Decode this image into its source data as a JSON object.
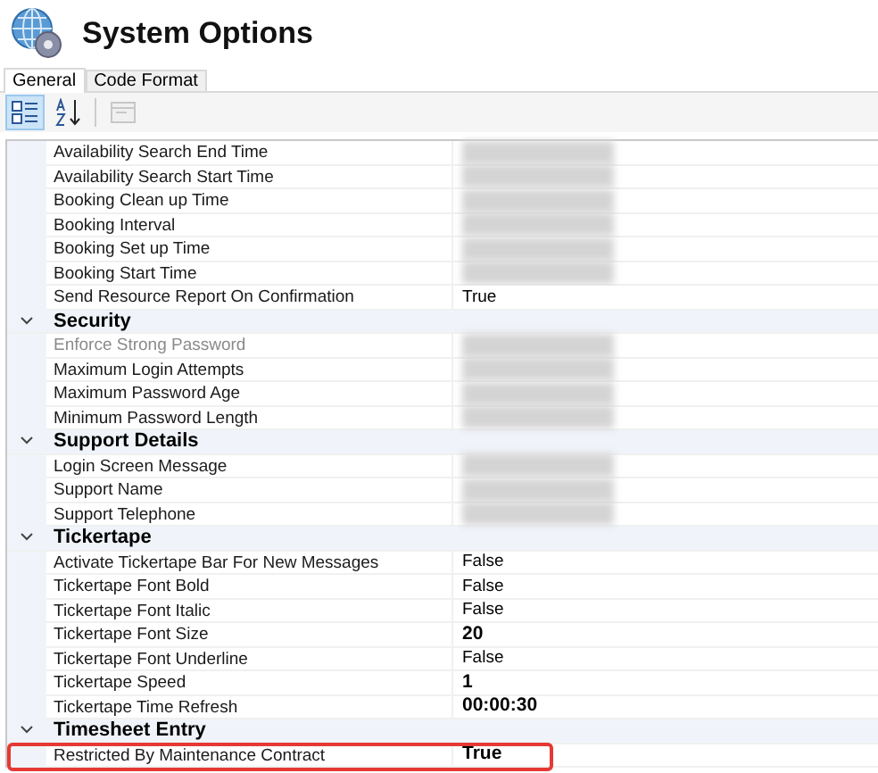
{
  "window": {
    "title": "System Options"
  },
  "tabs": [
    {
      "label": "General",
      "selected": true
    },
    {
      "label": "Code Format",
      "selected": false
    }
  ],
  "toolbar": [
    {
      "kind": "categorized",
      "selected": true,
      "disabled": false
    },
    {
      "kind": "alphabetical",
      "selected": false,
      "disabled": false
    },
    {
      "kind": "pages",
      "selected": false,
      "disabled": true
    }
  ],
  "grid": [
    {
      "kind": "property",
      "name": "Availability Search End Time",
      "redacted": true
    },
    {
      "kind": "property",
      "name": "Availability Search Start Time",
      "redacted": true
    },
    {
      "kind": "property",
      "name": "Booking Clean up Time",
      "redacted": true
    },
    {
      "kind": "property",
      "name": "Booking Interval",
      "redacted": true
    },
    {
      "kind": "property",
      "name": "Booking Set up Time",
      "redacted": true
    },
    {
      "kind": "property",
      "name": "Booking Start Time",
      "redacted": true
    },
    {
      "kind": "property",
      "name": "Send Resource Report On Confirmation",
      "value": "True",
      "modified": false
    },
    {
      "kind": "category",
      "name": "Security",
      "expanded": true
    },
    {
      "kind": "property",
      "name": "Enforce Strong Password",
      "redacted": true,
      "disabled": true
    },
    {
      "kind": "property",
      "name": "Maximum Login Attempts",
      "redacted": true
    },
    {
      "kind": "property",
      "name": "Maximum Password Age",
      "redacted": true
    },
    {
      "kind": "property",
      "name": "Minimum Password Length",
      "redacted": true
    },
    {
      "kind": "category",
      "name": "Support Details",
      "expanded": true
    },
    {
      "kind": "property",
      "name": "Login Screen Message",
      "redacted": true
    },
    {
      "kind": "property",
      "name": "Support Name",
      "redacted": true
    },
    {
      "kind": "property",
      "name": "Support Telephone",
      "redacted": true
    },
    {
      "kind": "category",
      "name": "Tickertape",
      "expanded": true
    },
    {
      "kind": "property",
      "name": "Activate Tickertape Bar For New Messages",
      "value": "False",
      "modified": false
    },
    {
      "kind": "property",
      "name": "Tickertape Font Bold",
      "value": "False",
      "modified": false
    },
    {
      "kind": "property",
      "name": "Tickertape Font Italic",
      "value": "False",
      "modified": false
    },
    {
      "kind": "property",
      "name": "Tickertape Font Size",
      "value": "20",
      "modified": true
    },
    {
      "kind": "property",
      "name": "Tickertape Font Underline",
      "value": "False",
      "modified": false
    },
    {
      "kind": "property",
      "name": "Tickertape Speed",
      "value": "1",
      "modified": true
    },
    {
      "kind": "property",
      "name": "Tickertape Time Refresh",
      "value": "00:00:30",
      "modified": true
    },
    {
      "kind": "category",
      "name": "Timesheet Entry",
      "expanded": true
    },
    {
      "kind": "property",
      "name": "Restricted By Maintenance Contract",
      "value": "True",
      "modified": true,
      "highlighted": true
    }
  ]
}
